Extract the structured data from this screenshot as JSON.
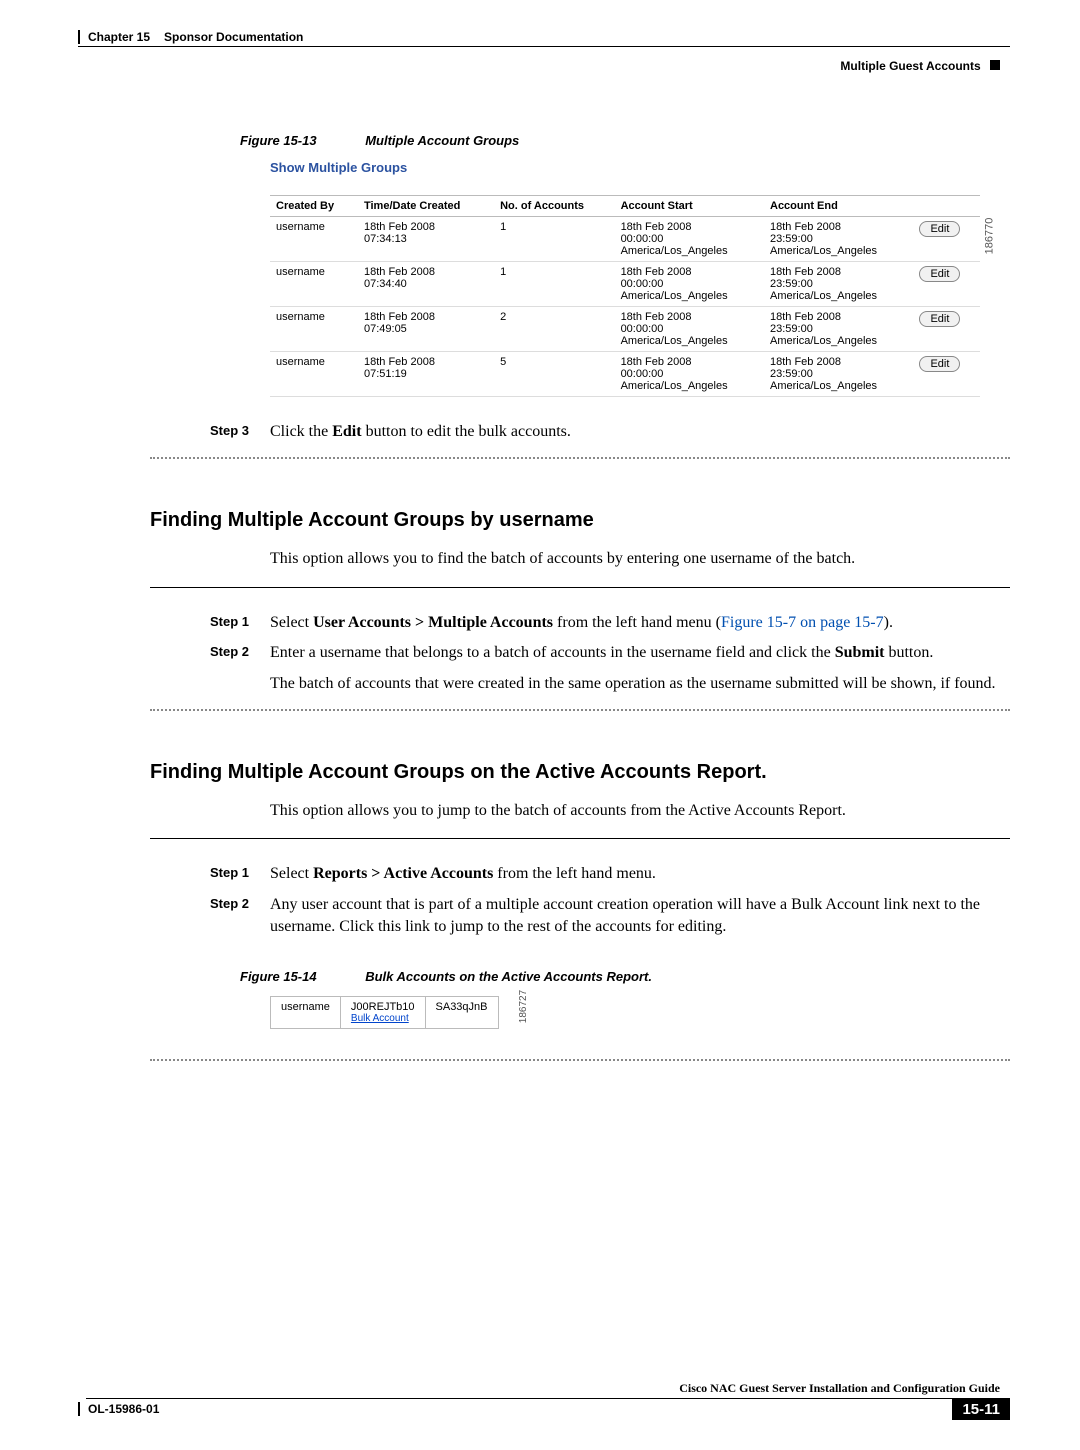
{
  "header": {
    "chapter": "Chapter 15",
    "title": "Sponsor Documentation",
    "section": "Multiple Guest Accounts"
  },
  "fig13": {
    "label": "Figure 15-13",
    "title": "Multiple Account Groups",
    "heading": "Show Multiple Groups",
    "ref": "186770",
    "cols": [
      "Created By",
      "Time/Date Created",
      "No. of Accounts",
      "Account Start",
      "Account End",
      ""
    ],
    "rows": [
      {
        "by": "username",
        "created": "18th Feb 2008\n07:34:13",
        "num": "1",
        "start": "18th Feb 2008\n00:00:00\nAmerica/Los_Angeles",
        "end": "18th Feb 2008\n23:59:00\nAmerica/Los_Angeles",
        "btn": "Edit"
      },
      {
        "by": "username",
        "created": "18th Feb 2008\n07:34:40",
        "num": "1",
        "start": "18th Feb 2008\n00:00:00\nAmerica/Los_Angeles",
        "end": "18th Feb 2008\n23:59:00\nAmerica/Los_Angeles",
        "btn": "Edit"
      },
      {
        "by": "username",
        "created": "18th Feb 2008\n07:49:05",
        "num": "2",
        "start": "18th Feb 2008\n00:00:00\nAmerica/Los_Angeles",
        "end": "18th Feb 2008\n23:59:00\nAmerica/Los_Angeles",
        "btn": "Edit"
      },
      {
        "by": "username",
        "created": "18th Feb 2008\n07:51:19",
        "num": "5",
        "start": "18th Feb 2008\n00:00:00\nAmerica/Los_Angeles",
        "end": "18th Feb 2008\n23:59:00\nAmerica/Los_Angeles",
        "btn": "Edit"
      }
    ]
  },
  "step3": {
    "label": "Step 3",
    "text_pre": "Click the ",
    "bold": "Edit",
    "text_post": " button to edit the bulk accounts."
  },
  "section1": {
    "title": "Finding Multiple Account Groups by username",
    "intro": "This option allows you to find the batch of accounts by entering one username of the batch.",
    "step1": {
      "label": "Step 1",
      "pre": "Select ",
      "bold": "User Accounts > Multiple Accounts",
      "mid": " from the left hand menu (",
      "link": "Figure 15-7 on page 15-7",
      "post": ")."
    },
    "step2": {
      "label": "Step 2",
      "line1_pre": "Enter a username that belongs to a batch of accounts in the username field and click the ",
      "line1_bold": "Submit",
      "line1_post": " button.",
      "line2": "The batch of accounts that were created in the same operation as the username submitted will be shown, if found."
    }
  },
  "section2": {
    "title": "Finding Multiple Account Groups on the Active Accounts Report.",
    "intro": "This option allows you to jump to the batch of accounts from the Active Accounts Report.",
    "step1": {
      "label": "Step 1",
      "pre": "Select ",
      "bold": "Reports > Active Accounts",
      "post": " from the left hand menu."
    },
    "step2": {
      "label": "Step 2",
      "text": "Any user account that is part of a multiple account creation operation will have a Bulk Account link next to the username. Click this link to jump to the rest of the accounts for editing."
    }
  },
  "fig14": {
    "label": "Figure 15-14",
    "title": "Bulk Accounts on the Active Accounts Report.",
    "ref": "186727",
    "row": {
      "c1": "username",
      "c2_top": "J00REJTb10",
      "c2_link": "Bulk Account",
      "c3": "SA33qJnB"
    }
  },
  "footer": {
    "book": "Cisco NAC Guest Server Installation and Configuration Guide",
    "doc": "OL-15986-01",
    "page": "15-11"
  }
}
